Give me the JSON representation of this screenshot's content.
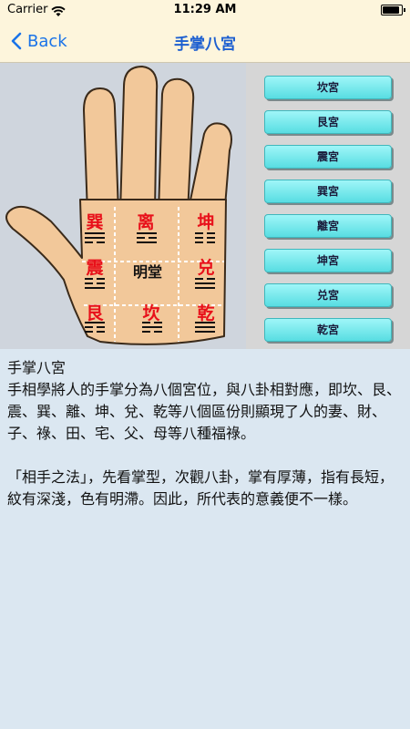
{
  "status": {
    "carrier": "Carrier",
    "time": "11:29 AM"
  },
  "nav": {
    "back_label": "Back",
    "title": "手掌八宮"
  },
  "palm": {
    "grid": [
      {
        "name": "巽",
        "lines": [
          1,
          1,
          0
        ]
      },
      {
        "name": "离",
        "lines": [
          1,
          0,
          1
        ]
      },
      {
        "name": "坤",
        "lines": [
          0,
          0,
          0
        ]
      },
      {
        "name": "震",
        "lines": [
          0,
          0,
          1
        ]
      },
      {
        "name": "明堂",
        "lines": []
      },
      {
        "name": "兑",
        "lines": [
          0,
          1,
          1
        ]
      },
      {
        "name": "艮",
        "lines": [
          1,
          0,
          0
        ]
      },
      {
        "name": "坎",
        "lines": [
          0,
          1,
          0
        ]
      },
      {
        "name": "乾",
        "lines": [
          1,
          1,
          1
        ]
      }
    ]
  },
  "buttons": [
    "坎宮",
    "艮宮",
    "震宮",
    "巽宮",
    "離宮",
    "坤宮",
    "兑宮",
    "乾宮"
  ],
  "content": {
    "heading": "手掌八宮",
    "para1": "手相學將人的手掌分為八個宮位，與八卦相對應，即坎、艮、震、巽、離、坤、兌、乾等八個區份則顯現了人的妻、財、子、祿、田、宅、父、母等八種福祿。",
    "para2": "「相手之法」，先看掌型，次觀八卦，掌有厚薄，指有長短，紋有深淺，色有明滯。因此，所代表的意義便不一樣。"
  }
}
